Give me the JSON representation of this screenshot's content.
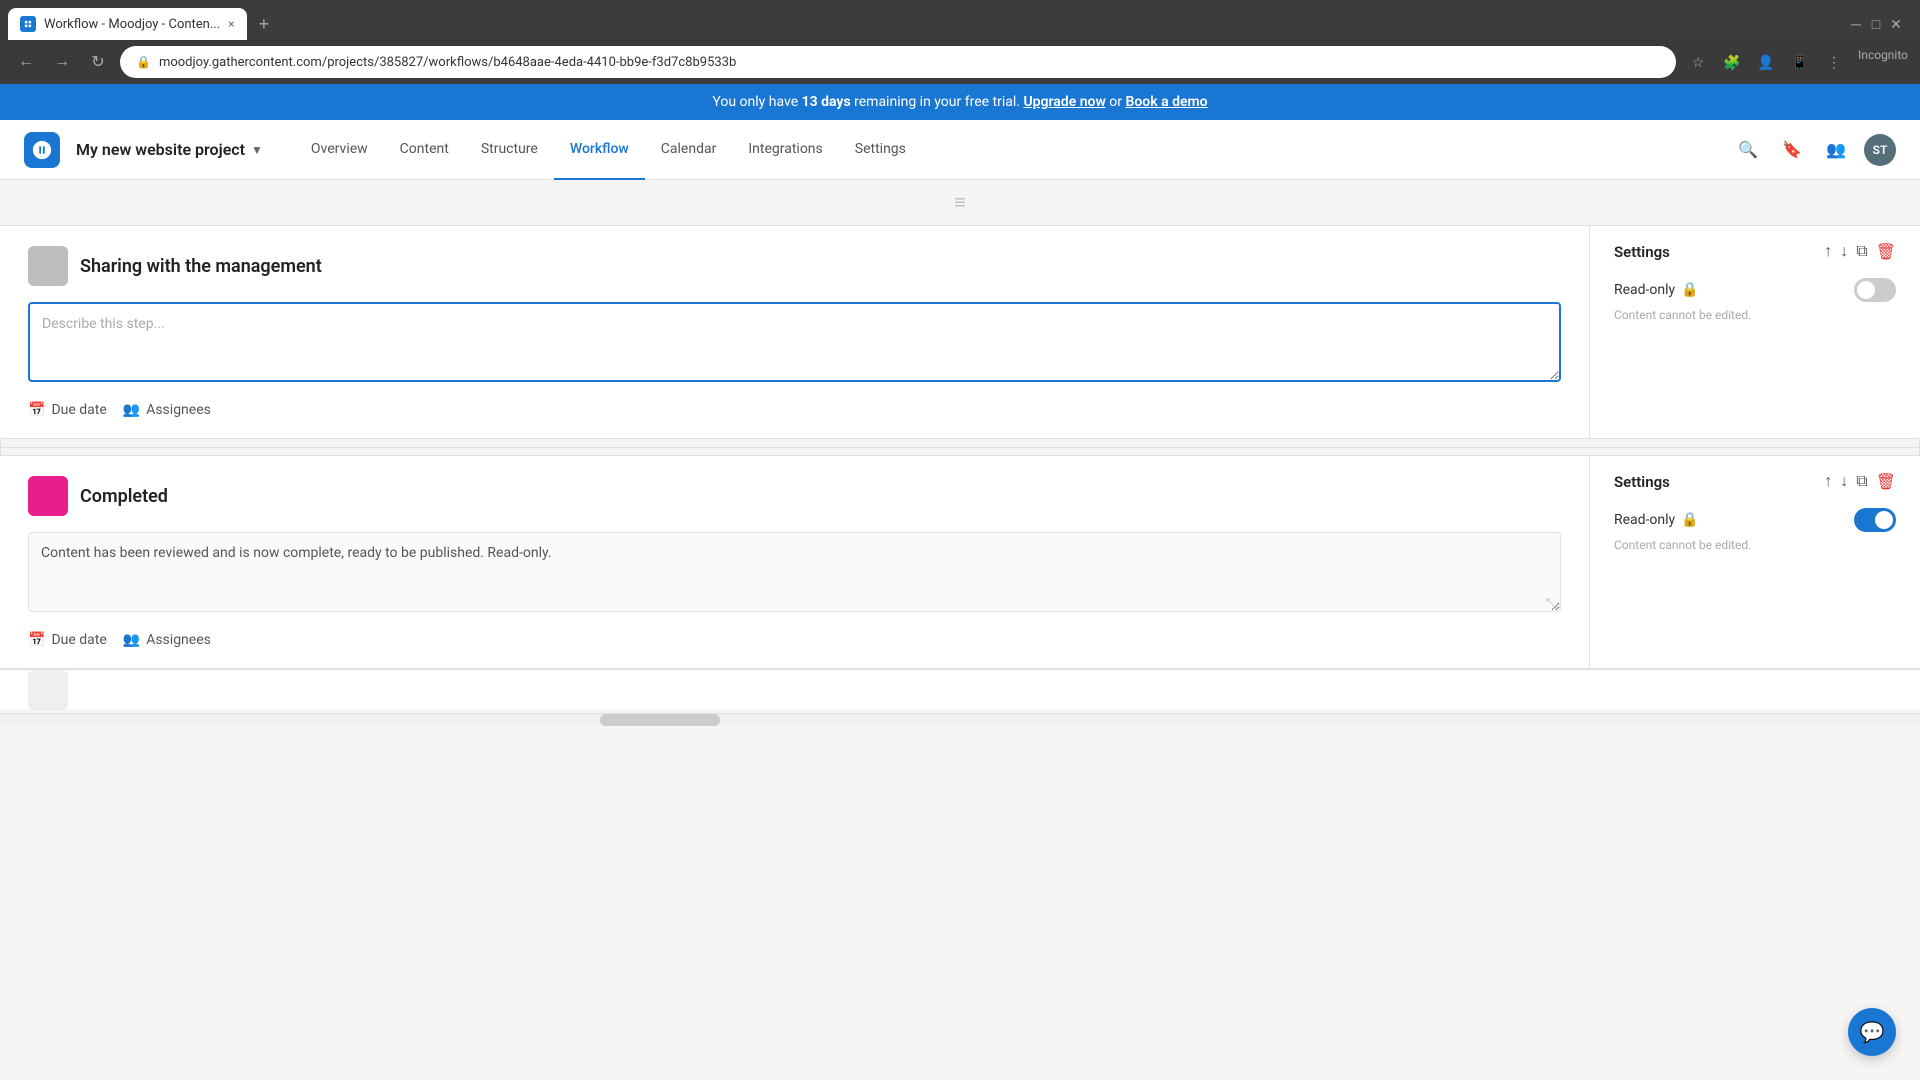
{
  "browser": {
    "tab_title": "Workflow - Moodjoy - Conten...",
    "tab_close": "×",
    "new_tab": "+",
    "url": "moodjoy.gathercontent.com/projects/385827/workflows/b4648aae-4eda-4410-bb9e-f3d7c8b9533b",
    "incognito_label": "Incognito"
  },
  "banner": {
    "text_prefix": "You only have ",
    "days": "13 days",
    "text_middle": " remaining in your free trial.",
    "upgrade_text": "Upgrade now",
    "or_text": " or ",
    "demo_text": "Book a demo"
  },
  "header": {
    "project_name": "My new website project",
    "nav_items": [
      {
        "label": "Overview",
        "active": false
      },
      {
        "label": "Content",
        "active": false
      },
      {
        "label": "Structure",
        "active": false
      },
      {
        "label": "Workflow",
        "active": true
      },
      {
        "label": "Calendar",
        "active": false
      },
      {
        "label": "Integrations",
        "active": false
      },
      {
        "label": "Settings",
        "active": false
      }
    ],
    "avatar_initials": "ST"
  },
  "step1": {
    "title": "Sharing with the management",
    "color": "gray",
    "description_placeholder": "Describe this step...",
    "description_value": "",
    "settings_title": "Settings",
    "readonly_label": "Read-only",
    "readonly_note": "Content cannot be edited.",
    "readonly_enabled": false,
    "due_date_label": "Due date",
    "assignees_label": "Assignees"
  },
  "step2": {
    "title": "Completed",
    "color": "pink",
    "description_value": "Content has been reviewed and is now complete, ready to be published. Read-only.",
    "settings_title": "Settings",
    "readonly_label": "Read-only",
    "readonly_note": "Content cannot be edited.",
    "readonly_enabled": true,
    "due_date_label": "Due date",
    "assignees_label": "Assignees"
  },
  "icons": {
    "up_arrow": "↑",
    "down_arrow": "↓",
    "delete": "🗑",
    "lock": "🔒",
    "calendar": "📅",
    "assignees": "👤",
    "drag_handle": "≡",
    "chat": "💬",
    "search": "🔍",
    "bookmark": "🔖",
    "extensions": "🧩",
    "responsive": "📱",
    "profile": "👤",
    "back": "←",
    "forward": "→",
    "refresh": "↻"
  }
}
